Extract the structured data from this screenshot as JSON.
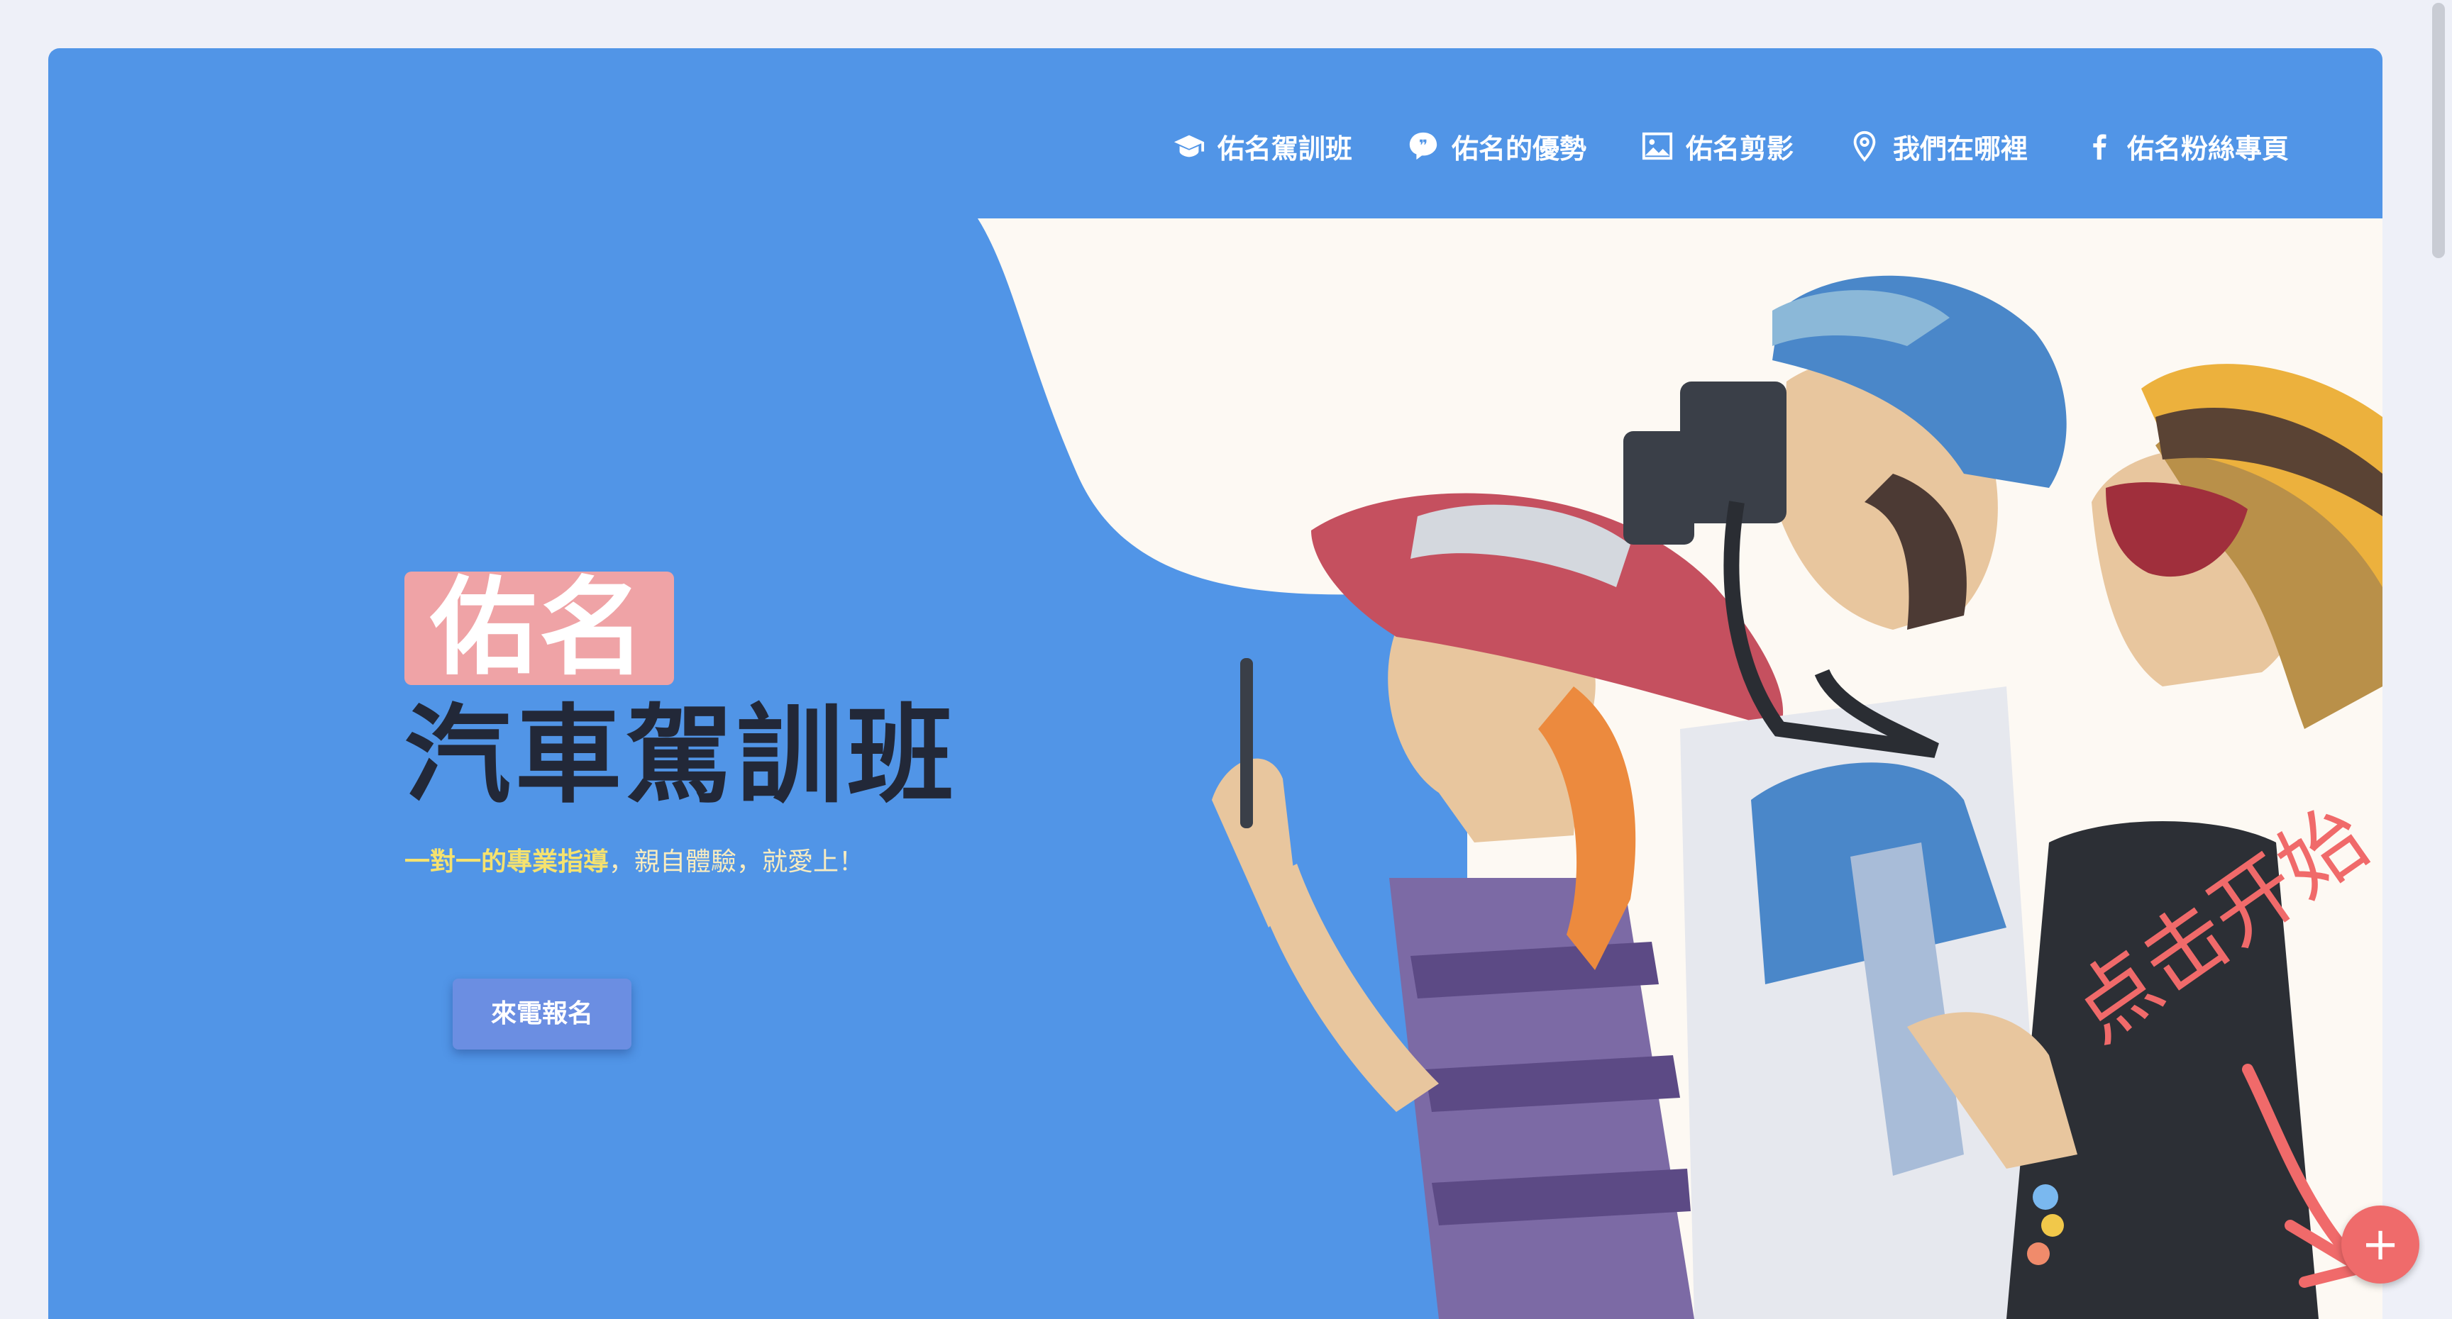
{
  "nav": {
    "items": [
      {
        "label": "佑名駕訓班",
        "icon": "graduation-cap-icon"
      },
      {
        "label": "佑名的優勢",
        "icon": "quote-bubble-icon"
      },
      {
        "label": "佑名剪影",
        "icon": "image-icon"
      },
      {
        "label": "我們在哪裡",
        "icon": "map-pin-icon"
      },
      {
        "label": "佑名粉絲專頁",
        "icon": "facebook-icon"
      }
    ]
  },
  "hero": {
    "brand": "佑名",
    "headline": "汽車駕訓班",
    "tagline_highlight": "一對一的專業指導",
    "tagline_rest": "，親自體驗，就愛上！",
    "cta_label": "來電報名",
    "illustration": "travelers-illustration"
  },
  "overlay": {
    "hint_text": "点击开始",
    "fab_label": "+"
  },
  "colors": {
    "hero_bg": "#5195e7",
    "brand_tag": "#efa3a6",
    "headline": "#222838",
    "tagline": "#f5e26f",
    "cta": "#6b8ee2",
    "accent_red": "#ef6b6b"
  }
}
